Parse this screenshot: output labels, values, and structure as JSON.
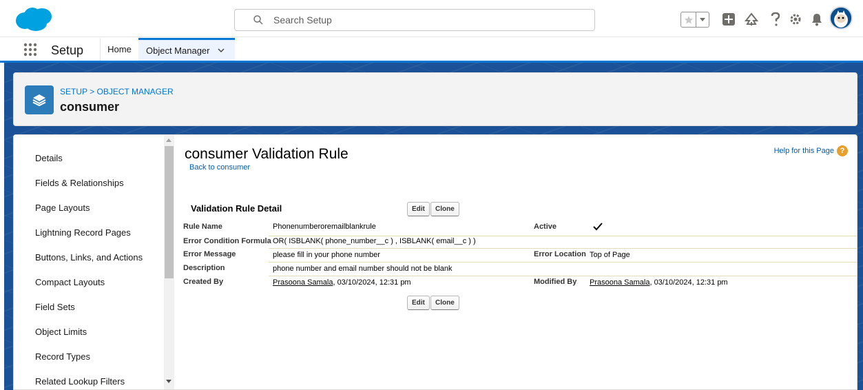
{
  "header": {
    "search_placeholder": "Search Setup",
    "brand_color": "#0176d3",
    "icons": [
      "star-icon",
      "chevron-down-icon",
      "add-icon",
      "trailhead-icon",
      "help-icon",
      "gear-icon",
      "bell-icon"
    ]
  },
  "nav": {
    "app_name": "Setup",
    "home": "Home",
    "object_manager": "Object Manager"
  },
  "object_header": {
    "breadcrumb_setup": "SETUP",
    "breadcrumb_sep": ">",
    "breadcrumb_om": "OBJECT MANAGER",
    "title": "consumer"
  },
  "sidebar": {
    "items": [
      "Details",
      "Fields & Relationships",
      "Page Layouts",
      "Lightning Record Pages",
      "Buttons, Links, and Actions",
      "Compact Layouts",
      "Field Sets",
      "Object Limits",
      "Record Types",
      "Related Lookup Filters"
    ]
  },
  "main": {
    "title": "consumer Validation Rule",
    "back_link": "Back to consumer",
    "help": "Help for this Page",
    "section_title": "Validation Rule Detail",
    "edit_label": "Edit",
    "clone_label": "Clone",
    "fields": {
      "rule_name_label": "Rule Name",
      "rule_name": "Phonenumberoremailblankrule",
      "active_label": "Active",
      "active": true,
      "formula_label": "Error Condition Formula",
      "formula": "OR( ISBLANK( phone_number__c ) , ISBLANK( email__c ) )",
      "message_label": "Error Message",
      "message": "please fill in your phone number",
      "location_label": "Error Location",
      "location": "Top of Page",
      "description_label": "Description",
      "description": "phone number and email number should not be blank",
      "created_by_label": "Created By",
      "created_by_user": "Prasoona Samala",
      "created_by_date": ", 03/10/2024, 12:31 pm",
      "modified_by_label": "Modified By",
      "modified_by_user": "Prasoona Samala",
      "modified_by_date": ", 03/10/2024, 12:31 pm"
    }
  }
}
